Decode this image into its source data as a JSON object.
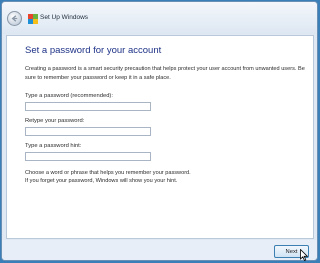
{
  "window": {
    "title": "Set Up Windows"
  },
  "page": {
    "heading": "Set a password for your account",
    "description": "Creating a password is a smart security precaution that helps protect your user account from unwanted users. Be sure to remember your password or keep it in a safe place."
  },
  "fields": {
    "password_label": "Type a password (recommended):",
    "password_value": "",
    "retype_label": "Retype your password:",
    "retype_value": "",
    "hint_label": "Type a password hint:",
    "hint_value": ""
  },
  "hint_text": {
    "line1": "Choose a word or phrase that helps you remember your password.",
    "line2": "If you forget your password, Windows will show you your hint."
  },
  "buttons": {
    "next_label": "Next"
  },
  "colors": {
    "heading": "#1e3287",
    "desktop": "#3a7fb8",
    "next_border": "#3c7fb1"
  },
  "icons": {
    "back": "back-arrow-icon",
    "app": "windows-logo-icon",
    "cursor": "mouse-pointer-icon"
  }
}
